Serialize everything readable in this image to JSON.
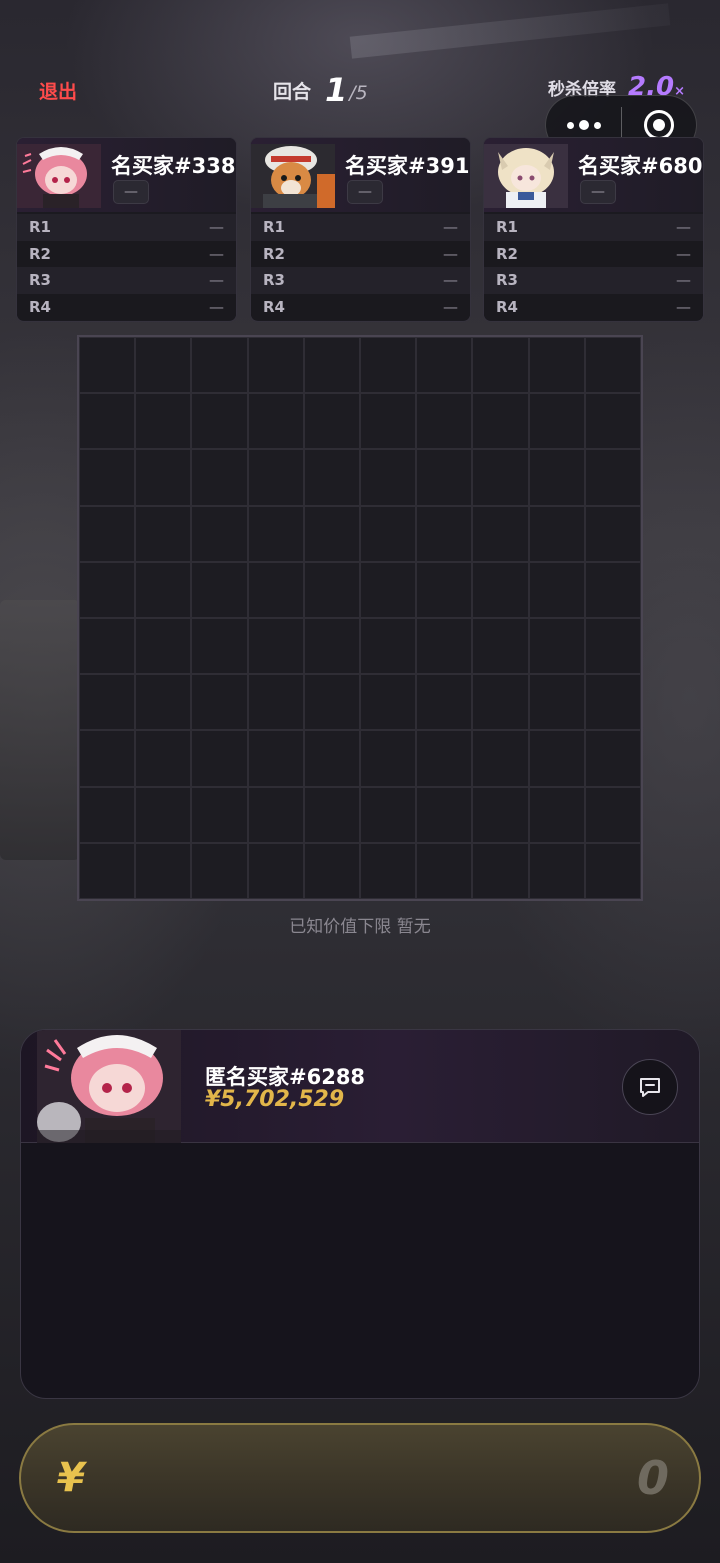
{
  "header": {
    "exit_label": "退出",
    "round_label": "回合",
    "round_current": "1",
    "round_total": "/5",
    "multiplier_label": "秒杀倍率",
    "multiplier_value": "2.0",
    "multiplier_suffix": "×"
  },
  "players": [
    {
      "name": "名买家#338",
      "chip": "—",
      "rounds": [
        {
          "label": "R1",
          "value": "—"
        },
        {
          "label": "R2",
          "value": "—"
        },
        {
          "label": "R3",
          "value": "—"
        },
        {
          "label": "R4",
          "value": "—"
        }
      ]
    },
    {
      "name": "名买家#391",
      "chip": "—",
      "rounds": [
        {
          "label": "R1",
          "value": "—"
        },
        {
          "label": "R2",
          "value": "—"
        },
        {
          "label": "R3",
          "value": "—"
        },
        {
          "label": "R4",
          "value": "—"
        }
      ]
    },
    {
      "name": "名买家#680",
      "chip": "—",
      "rounds": [
        {
          "label": "R1",
          "value": "—"
        },
        {
          "label": "R2",
          "value": "—"
        },
        {
          "label": "R3",
          "value": "—"
        },
        {
          "label": "R4",
          "value": "—"
        }
      ]
    }
  ],
  "grid": {
    "rows": 10,
    "cols": 10
  },
  "hint": "已知价值下限 暂无",
  "me": {
    "name": "匿名买家#6288",
    "money": "¥5,702,529"
  },
  "bid": {
    "currency": "¥",
    "amount": "0"
  },
  "colors": {
    "accent_purple": "#b57bff",
    "gold": "#e2b64a",
    "exit_red": "#ff4b4b"
  }
}
